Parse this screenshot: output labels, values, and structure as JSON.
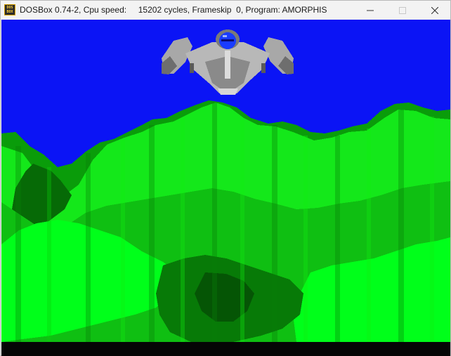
{
  "window": {
    "title": "DOSBox 0.74-2, Cpu speed:     15202 cycles, Frameskip  0, Program: AMORPHIS",
    "icon_name": "dosbox-icon",
    "icon_text_top": "DOS",
    "icon_text_bottom": "BOX",
    "controls": {
      "minimize_icon": "minimize-icon",
      "maximize_icon": "maximize-icon",
      "close_icon": "close-icon"
    }
  },
  "game": {
    "program": "AMORPHIS",
    "sky_color": "#0b14f5",
    "terrain_colors": [
      "#00ff1a",
      "#14e81a",
      "#0a9c0a",
      "#066a06"
    ],
    "ship_color": "#a8a8a8",
    "cockpit_color": "#1a3cff",
    "bottom_bar_color": "#050505"
  }
}
